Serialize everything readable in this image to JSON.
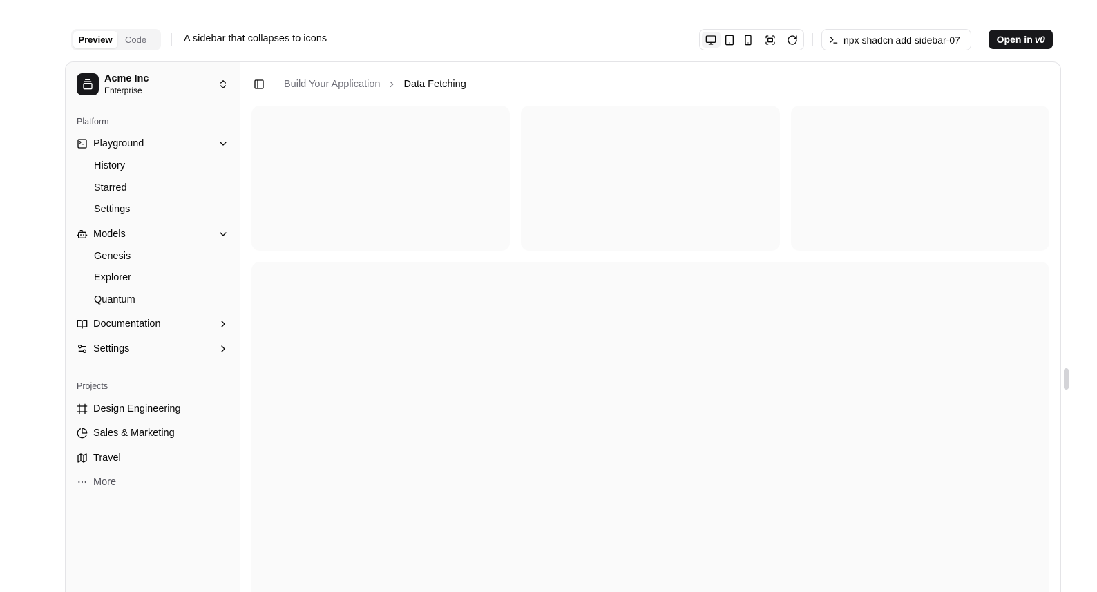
{
  "toolbar": {
    "tabs": [
      {
        "label": "Preview",
        "active": true
      },
      {
        "label": "Code",
        "active": false
      }
    ],
    "block_title": "A sidebar that collapses to icons",
    "view_buttons": [
      "monitor-icon",
      "tablet-icon",
      "smartphone-icon",
      "fullscreen-icon",
      "refresh-icon"
    ],
    "install_command": "npx shadcn add sidebar-07",
    "open_in_label": "Open in",
    "open_in_brand": "v0"
  },
  "sidebar": {
    "team": {
      "name": "Acme Inc",
      "plan": "Enterprise"
    },
    "platform_label": "Platform",
    "platform_items": [
      {
        "label": "Playground",
        "icon": "square-terminal-icon",
        "expanded": true,
        "children": [
          "History",
          "Starred",
          "Settings"
        ]
      },
      {
        "label": "Models",
        "icon": "bot-icon",
        "expanded": true,
        "children": [
          "Genesis",
          "Explorer",
          "Quantum"
        ]
      },
      {
        "label": "Documentation",
        "icon": "book-open-icon",
        "expanded": false,
        "children": []
      },
      {
        "label": "Settings",
        "icon": "settings-2-icon",
        "expanded": false,
        "children": []
      }
    ],
    "projects_label": "Projects",
    "projects": [
      {
        "label": "Design Engineering",
        "icon": "frame-icon"
      },
      {
        "label": "Sales & Marketing",
        "icon": "pie-chart-icon"
      },
      {
        "label": "Travel",
        "icon": "map-icon"
      }
    ],
    "more_label": "More"
  },
  "breadcrumb": {
    "parent": "Build Your Application",
    "current": "Data Fetching"
  },
  "colors": {
    "accent": "#18181b",
    "muted_text": "#71717a",
    "border": "#e4e4e7",
    "card_bg": "#fafafa"
  }
}
